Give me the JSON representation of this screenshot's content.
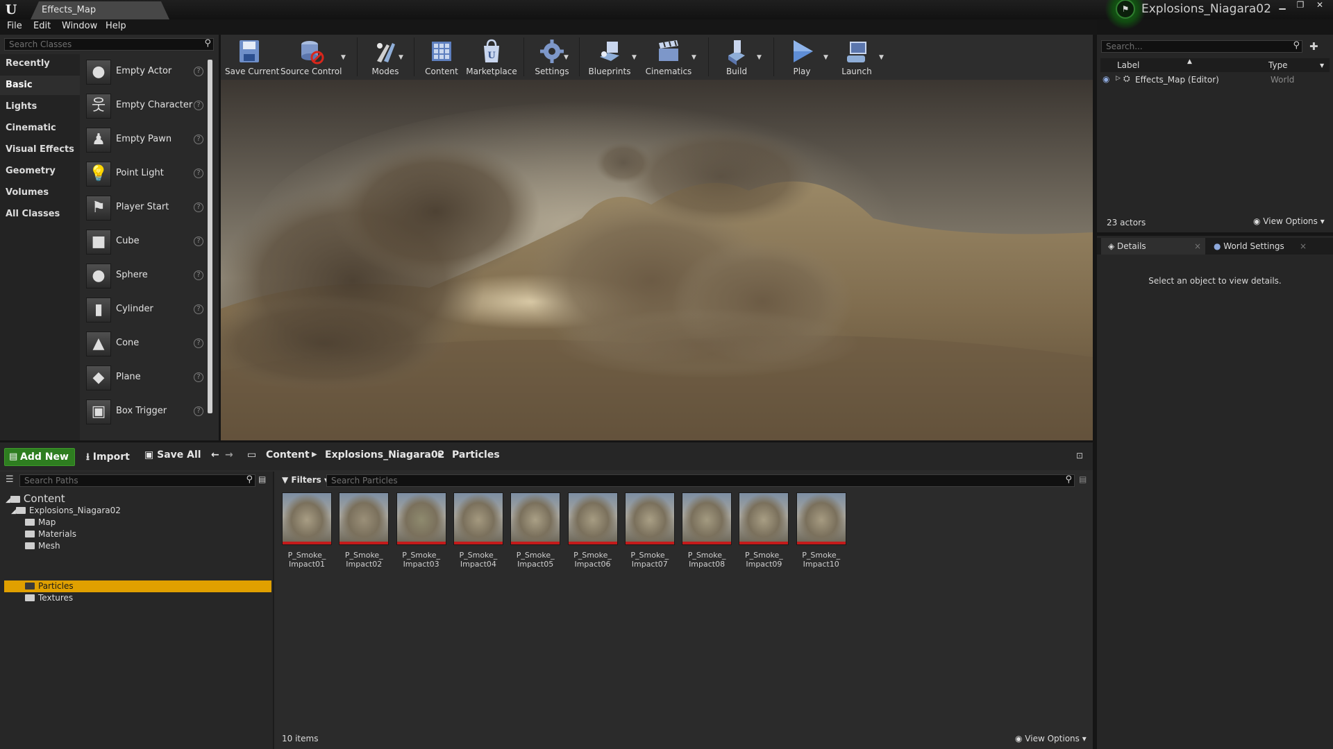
{
  "title_bar": {
    "level_tab": "Effects_Map",
    "project_name": "Explosions_Niagara02",
    "window_buttons": [
      "minimize",
      "restore",
      "close"
    ]
  },
  "menu": [
    "File",
    "Edit",
    "Window",
    "Help"
  ],
  "place_mode": {
    "search_placeholder": "Search Classes",
    "categories": [
      "Recently Placed",
      "Basic",
      "Lights",
      "Cinematic",
      "Visual Effects",
      "Geometry",
      "Volumes",
      "All Classes"
    ],
    "active_category": "Basic",
    "items": [
      {
        "label": "Empty Actor",
        "icon": "sphere-icon"
      },
      {
        "label": "Empty Character",
        "icon": "character-icon"
      },
      {
        "label": "Empty Pawn",
        "icon": "pawn-icon"
      },
      {
        "label": "Point Light",
        "icon": "light-bulb-icon"
      },
      {
        "label": "Player Start",
        "icon": "flag-icon"
      },
      {
        "label": "Cube",
        "icon": "cube-icon"
      },
      {
        "label": "Sphere",
        "icon": "sphere-icon"
      },
      {
        "label": "Cylinder",
        "icon": "cylinder-icon"
      },
      {
        "label": "Cone",
        "icon": "cone-icon"
      },
      {
        "label": "Plane",
        "icon": "plane-icon"
      },
      {
        "label": "Box Trigger",
        "icon": "box-trigger-icon"
      }
    ]
  },
  "toolbar": {
    "buttons": [
      {
        "label": "Save Current",
        "icon": "save-icon"
      },
      {
        "label": "Source Control",
        "icon": "source-control-icon"
      },
      {
        "label": "Modes",
        "icon": "modes-icon"
      },
      {
        "label": "Content",
        "icon": "content-icon"
      },
      {
        "label": "Marketplace",
        "icon": "marketplace-icon"
      },
      {
        "label": "Settings",
        "icon": "settings-icon"
      },
      {
        "label": "Blueprints",
        "icon": "blueprints-icon"
      },
      {
        "label": "Cinematics",
        "icon": "cinematics-icon"
      },
      {
        "label": "Build",
        "icon": "build-icon"
      },
      {
        "label": "Play",
        "icon": "play-icon"
      },
      {
        "label": "Launch",
        "icon": "launch-icon"
      }
    ]
  },
  "outliner": {
    "search_placeholder": "Search...",
    "col_label": "Label",
    "col_type": "Type",
    "rows": [
      {
        "label": "Effects_Map (Editor)",
        "type": "World"
      }
    ],
    "actor_count": "23 actors",
    "view_options": "View Options"
  },
  "details": {
    "tabs": [
      "Details",
      "World Settings"
    ],
    "message": "Select an object to view details."
  },
  "content_browser": {
    "add_new": "Add New",
    "import": "Import",
    "save_all": "Save All",
    "breadcrumb": [
      "Content",
      "Explosions_Niagara02",
      "Particles"
    ],
    "path_search_placeholder": "Search Paths",
    "filters": "Filters",
    "asset_search_placeholder": "Search Particles",
    "tree": {
      "root": "Content",
      "project": "Explosions_Niagara02",
      "folders": [
        "Map",
        "Materials",
        "Mesh",
        "Particles",
        "Textures"
      ],
      "selected": "Particles"
    },
    "assets": [
      {
        "line1": "P_Smoke_",
        "line2": "Impact01"
      },
      {
        "line1": "P_Smoke_",
        "line2": "Impact02"
      },
      {
        "line1": "P_Smoke_",
        "line2": "Impact03"
      },
      {
        "line1": "P_Smoke_",
        "line2": "Impact04"
      },
      {
        "line1": "P_Smoke_",
        "line2": "Impact05"
      },
      {
        "line1": "P_Smoke_",
        "line2": "Impact06"
      },
      {
        "line1": "P_Smoke_",
        "line2": "Impact07"
      },
      {
        "line1": "P_Smoke_",
        "line2": "Impact08"
      },
      {
        "line1": "P_Smoke_",
        "line2": "Impact09"
      },
      {
        "line1": "P_Smoke_",
        "line2": "Impact10"
      }
    ],
    "item_count": "10 items",
    "view_options": "View Options"
  },
  "colors": {
    "add_new_green": "#2e7d20",
    "selected_folder": "#e0a000",
    "asset_type_bar": "#c41a1a",
    "panel_bg": "#262626"
  }
}
